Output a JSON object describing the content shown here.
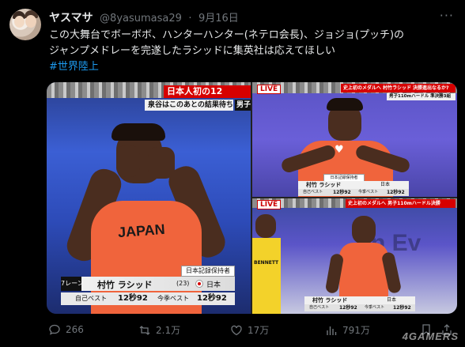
{
  "post": {
    "display_name": "ヤスマサ",
    "handle": "@8yasumasa29",
    "separator": "·",
    "date": "9月16日",
    "text_lines": [
      "この大舞台でボーボボ、ハンターハンター(ネテロ会長)、ジョジョ(プッチ)の",
      "ジャンプメドレーを完遂したラシッドに集英社は応えてほしい"
    ],
    "hashtag": "#世界陸上"
  },
  "media": {
    "panel1": {
      "banner_top": "日本人初の12",
      "banner_sub": "泉谷はこのあとの結果待ち",
      "banner_sub2": "男子",
      "vest_text": "JAPAN",
      "record_tag": "日本記録保持者",
      "lane": "7レーン",
      "runner_name": "村竹 ラシッド",
      "age": "(23)",
      "country": "日本",
      "pb_label": "自己ベスト",
      "pb_value": "12秒92",
      "sb_label": "今季ベスト",
      "sb_value": "12秒92"
    },
    "panel2": {
      "live": "LIVE",
      "banner_top": "史上初のメダルへ 村竹ラシッド 決勝進出なるか?",
      "banner_sub": "男子110mハードル 準決勝3組",
      "record_tag": "日本記録保持者",
      "runner_name": "村竹 ラシッド",
      "country": "日本",
      "pb_label": "自己ベスト",
      "pb_value": "12秒92",
      "sb_label": "今季ベスト",
      "sb_value": "12秒92"
    },
    "panel3": {
      "live": "LIVE",
      "banner_top": "史上初のメダルへ 男子110mハードル決勝",
      "bib_text": "BENNETT",
      "runner_name": "村竹 ラシッド",
      "country": "日本",
      "pb_label": "自己ベスト",
      "pb_value": "12秒92",
      "sb_label": "今季ベスト",
      "sb_value": "12秒92"
    }
  },
  "actions": {
    "replies": "266",
    "reposts": "2.1万",
    "likes": "17万",
    "views": "791万"
  },
  "watermark": "4GAMERS",
  "colors": {
    "background": "#000000",
    "text": "#e7e9ea",
    "muted": "#71767b",
    "link": "#1d9bf0"
  }
}
